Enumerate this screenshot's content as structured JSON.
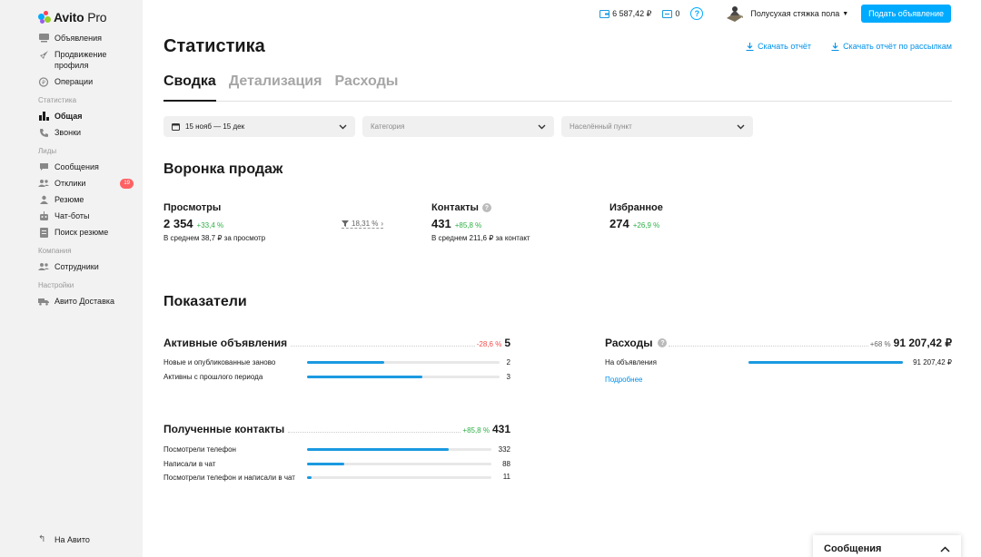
{
  "logo": {
    "brand": "Avito",
    "suffix": "Pro"
  },
  "sidebar": {
    "items": [
      {
        "label": "Объявления",
        "icon": "ads-icon"
      },
      {
        "label": "Продвижение профиля",
        "icon": "rocket-icon"
      },
      {
        "label": "Операции",
        "icon": "operations-icon"
      }
    ],
    "sections": {
      "stats": "Статистика",
      "leads": "Лиды",
      "company": "Компания",
      "settings": "Настройки"
    },
    "stats_items": [
      {
        "label": "Общая",
        "icon": "bar-chart-icon"
      },
      {
        "label": "Звонки",
        "icon": "phone-icon"
      }
    ],
    "leads_items": [
      {
        "label": "Сообщения",
        "icon": "chat-icon"
      },
      {
        "label": "Отклики",
        "icon": "people-icon",
        "badge": "19"
      },
      {
        "label": "Резюме",
        "icon": "resume-icon"
      },
      {
        "label": "Чат-боты",
        "icon": "bot-icon"
      },
      {
        "label": "Поиск резюме",
        "icon": "search-resume-icon"
      }
    ],
    "company_items": [
      {
        "label": "Сотрудники",
        "icon": "people-icon"
      }
    ],
    "settings_items": [
      {
        "label": "Авито Доставка",
        "icon": "truck-icon"
      }
    ],
    "back_label": "На Авито"
  },
  "topbar": {
    "balance": "6 587,42 ₽",
    "bonus": "0",
    "user_name": "Полусухая стяжка пола",
    "post_button": "Подать объявление"
  },
  "page": {
    "title": "Статистика",
    "download_report": "Скачать отчёт",
    "download_mailing_report": "Скачать отчёт по рассылкам"
  },
  "tabs": [
    "Сводка",
    "Детализация",
    "Расходы"
  ],
  "filters": {
    "date": "15 нояб — 15 дек",
    "category": "Категория",
    "city": "Населённый пункт"
  },
  "funnel": {
    "title": "Воронка продаж",
    "views": {
      "label": "Просмотры",
      "value": "2 354",
      "delta": "+33,4 %",
      "avg": "В среднем 38,7 ₽ за просмотр"
    },
    "conversion": "18,31 %",
    "contacts": {
      "label": "Контакты",
      "value": "431",
      "delta": "+85,8 %",
      "avg": "В среднем 211,6 ₽ за контакт"
    },
    "favorites": {
      "label": "Избранное",
      "value": "274",
      "delta": "+26,9 %"
    }
  },
  "indicators": {
    "title": "Показатели",
    "active_ads": {
      "title": "Активные объявления",
      "delta": "-28,6 %",
      "total": "5",
      "rows": [
        {
          "label": "Новые и опубликованные заново",
          "value": "2",
          "fraction": 0.4
        },
        {
          "label": "Активны с прошлого периода",
          "value": "3",
          "fraction": 0.6
        }
      ]
    },
    "expenses": {
      "title": "Расходы",
      "delta": "+68 %",
      "total": "91 207,42 ₽",
      "rows": [
        {
          "label": "На объявления",
          "value": "91 207,42 ₽",
          "fraction": 1.0
        }
      ],
      "more": "Подробнее"
    },
    "contacts": {
      "title": "Полученные контакты",
      "delta": "+85,8 %",
      "total": "431",
      "rows": [
        {
          "label": "Посмотрели телефон",
          "value": "332",
          "fraction": 0.77
        },
        {
          "label": "Написали в чат",
          "value": "88",
          "fraction": 0.2
        },
        {
          "label": "Посмотрели телефон и написали в чат",
          "value": "11",
          "fraction": 0.025
        }
      ]
    }
  },
  "messages_panel": {
    "label": "Сообщения"
  },
  "colors": {
    "accent": "#00aaff",
    "positive": "#2db046",
    "negative": "#f44b4b",
    "bar": "#1a9ae0"
  }
}
